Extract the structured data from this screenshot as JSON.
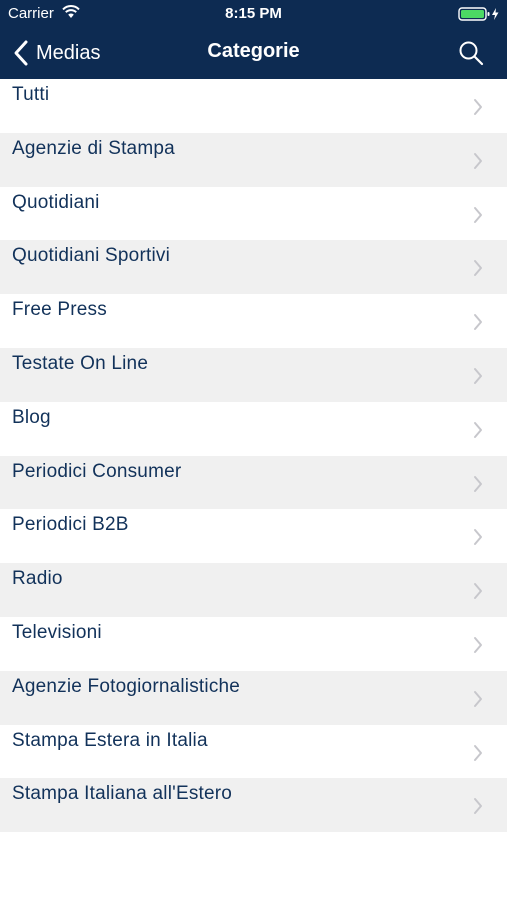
{
  "status_bar": {
    "carrier": "Carrier",
    "time": "8:15 PM"
  },
  "nav": {
    "back_label": "Medias",
    "title": "Categorie"
  },
  "colors": {
    "nav_background": "#0d2b52",
    "row_text": "#12325a",
    "row_alt_background": "#f0f0f0",
    "chevron": "#c7c7cc"
  },
  "categories": [
    {
      "label": "Tutti"
    },
    {
      "label": "Agenzie di Stampa"
    },
    {
      "label": "Quotidiani"
    },
    {
      "label": "Quotidiani Sportivi"
    },
    {
      "label": "Free Press"
    },
    {
      "label": "Testate On Line"
    },
    {
      "label": "Blog"
    },
    {
      "label": "Periodici Consumer"
    },
    {
      "label": "Periodici B2B"
    },
    {
      "label": "Radio"
    },
    {
      "label": "Televisioni"
    },
    {
      "label": "Agenzie Fotogiornalistiche"
    },
    {
      "label": "Stampa Estera in Italia"
    },
    {
      "label": "Stampa Italiana all'Estero"
    }
  ]
}
